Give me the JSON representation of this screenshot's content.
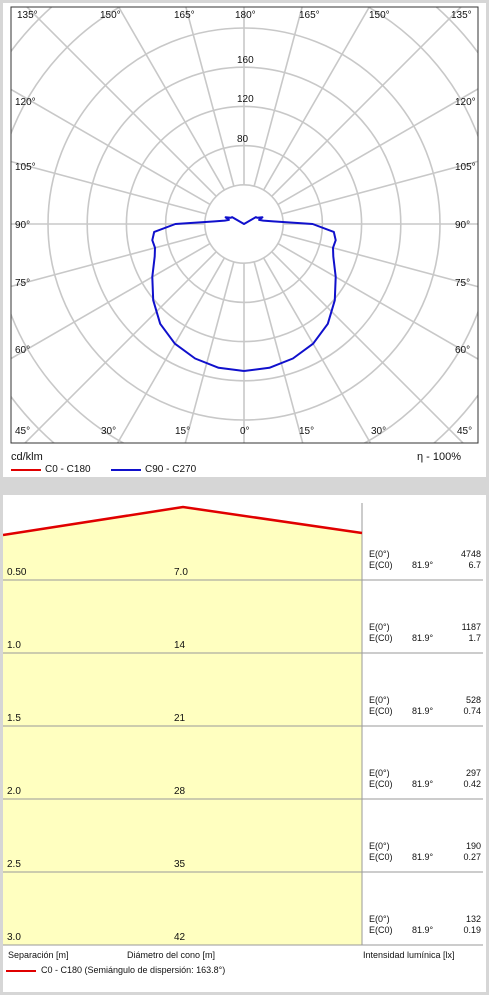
{
  "chart_data": [
    {
      "type": "polar",
      "unit_label": "cd/klm",
      "efficiency_label": "η  -  100%",
      "angle_labels": [
        "135°",
        "150°",
        "165°",
        "180°",
        "165°",
        "150°",
        "135°",
        "120°",
        "120°",
        "105°",
        "105°",
        "90°",
        "90°",
        "75°",
        "75°",
        "60°",
        "60°",
        "45°",
        "30°",
        "15°",
        "0°",
        "15°",
        "30°",
        "45°"
      ],
      "radial_labels": [
        "160",
        "120",
        "80"
      ],
      "rmax": 200,
      "radial_ticks": [
        40,
        80,
        120,
        160,
        200
      ],
      "grid": true,
      "series": [
        {
          "name": "C0 - C180",
          "color": "#e00000",
          "angles": [],
          "values": []
        },
        {
          "name": "C90 - C270",
          "color": "#1010cc",
          "angles": [
            0,
            10,
            20,
            30,
            40,
            50,
            60,
            70,
            75,
            80,
            85,
            90,
            95,
            100,
            105,
            110,
            115,
            120,
            125
          ],
          "values": [
            150,
            149,
            146,
            141,
            133,
            121,
            108,
            97,
            94,
            95,
            92,
            70,
            30,
            20,
            16,
            20,
            15,
            14,
            0
          ]
        }
      ],
      "legend": [
        {
          "name": "C0 - C180",
          "color": "#e00000"
        },
        {
          "name": "C90 - C270",
          "color": "#1010cc"
        }
      ]
    },
    {
      "type": "table",
      "col_headers": {
        "separation": "Separación [m]",
        "diameter": "Diámetro del cono [m]",
        "intensity": "Intensidad lumínica [lx]"
      },
      "legend_label": "C0 - C180 (Semiángulo de dispersión: 163.8°)",
      "legend_color": "#e00000",
      "rows": [
        {
          "separation": "0.50",
          "diameter": "7.0",
          "e0_label": "E(0°)",
          "ec0_label": "E(C0)",
          "angle": "81.9°",
          "e0": "4748",
          "ec0": "6.7"
        },
        {
          "separation": "1.0",
          "diameter": "14",
          "e0_label": "E(0°)",
          "ec0_label": "E(C0)",
          "angle": "81.9°",
          "e0": "1187",
          "ec0": "1.7"
        },
        {
          "separation": "1.5",
          "diameter": "21",
          "e0_label": "E(0°)",
          "ec0_label": "E(C0)",
          "angle": "81.9°",
          "e0": "528",
          "ec0": "0.74"
        },
        {
          "separation": "2.0",
          "diameter": "28",
          "e0_label": "E(0°)",
          "ec0_label": "E(C0)",
          "angle": "81.9°",
          "e0": "297",
          "ec0": "0.42"
        },
        {
          "separation": "2.5",
          "diameter": "35",
          "e0_label": "E(0°)",
          "ec0_label": "E(C0)",
          "angle": "81.9°",
          "e0": "190",
          "ec0": "0.27"
        },
        {
          "separation": "3.0",
          "diameter": "42",
          "e0_label": "E(0°)",
          "ec0_label": "E(C0)",
          "angle": "81.9°",
          "e0": "132",
          "ec0": "0.19"
        }
      ]
    }
  ]
}
